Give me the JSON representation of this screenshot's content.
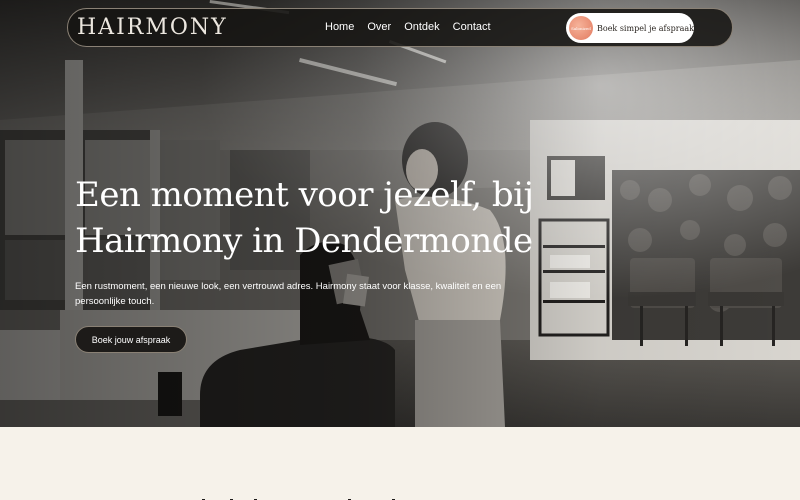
{
  "header": {
    "logo_text": "HAIRMONY",
    "nav": [
      {
        "label": "Home"
      },
      {
        "label": "Over"
      },
      {
        "label": "Ontdek"
      },
      {
        "label": "Contact"
      }
    ],
    "booking": {
      "label": "Boek simpel je afspraak",
      "badge_text": "Salonized"
    }
  },
  "hero": {
    "title_line1": "Een moment voor jezelf, bij",
    "title_line2": "Hairmony in Dendermonde",
    "description": "Een rustmoment, een nieuwe look, een vertrouwd adres. Hairmony staat voor klasse, kwaliteit en een persoonlijke touch.",
    "cta_label": "Boek jouw afspraak"
  },
  "colors": {
    "page_background": "#f6f2ea",
    "nav_background": "#161412",
    "accent_border": "#8a8175"
  }
}
